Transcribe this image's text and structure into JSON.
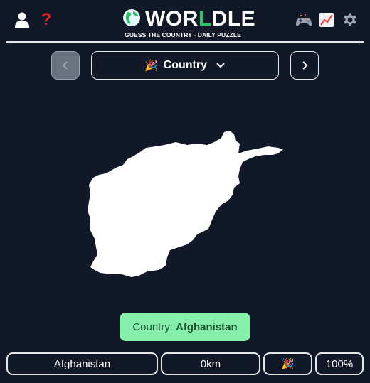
{
  "header": {
    "logo_prefix": "WOR",
    "logo_accent": "L",
    "logo_suffix": "DLE",
    "subtitle": "GUESS THE COUNTRY - DAILY PUZZLE",
    "help_symbol": "?",
    "icons": {
      "user": "user-icon",
      "help": "question-icon",
      "game": "game-controller-icon",
      "stats": "chart-icon",
      "settings": "gear-icon",
      "logo": "globe-icon"
    },
    "colors": {
      "accent": "#22c55e",
      "help": "#dc2626"
    }
  },
  "nav": {
    "prev_symbol": "‹",
    "select_emoji": "🎉",
    "select_label": "Country",
    "next_symbol": "›"
  },
  "map": {
    "country": "Afghanistan",
    "fill": "#ffffff"
  },
  "answer": {
    "prefix": "Country:",
    "value": "Afghanistan",
    "background": "#86efac",
    "text_color": "#14532d"
  },
  "guess": {
    "country": "Afghanistan",
    "distance": "0km",
    "direction": "🎉",
    "proximity": "100%"
  }
}
